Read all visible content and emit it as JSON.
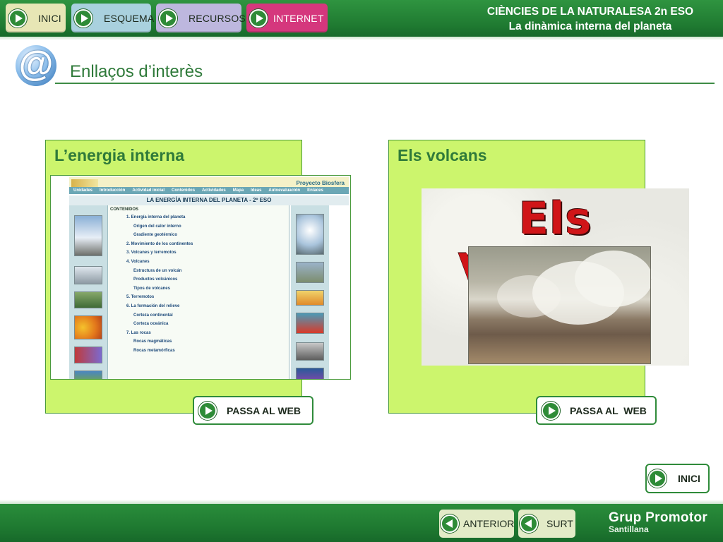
{
  "nav": {
    "inici": "INICI",
    "esquema": "ESQUEMA",
    "recursos": "RECURSOS",
    "internet": "INTERNET"
  },
  "header": {
    "course": "CIÈNCIES DE LA NATURALESA 2n ESO",
    "unit": "La dinàmica interna del planeta"
  },
  "page": {
    "icon": "at-icon",
    "title": "Enllaços d’interès"
  },
  "panels": [
    {
      "title": "L’energia interna",
      "button": "PASSA AL WEB",
      "screenshot": {
        "project": "Proyecto Biosfera",
        "menu": [
          "Unidades",
          "Introducción",
          "Actividad inicial",
          "Contenidos",
          "Actividades",
          "Mapa",
          "Ideas",
          "Autoevaluación",
          "Enlaces"
        ],
        "banner": "LA ENERGÍA INTERNA DEL PLANETA - 2º ESO",
        "contents_heading": "CONTENIDOS",
        "contents": [
          {
            "text": "1. Energía interna del planeta",
            "level": 1
          },
          {
            "text": "Origen del calor interno",
            "level": 2
          },
          {
            "text": "Gradiente geotérmico",
            "level": 2
          },
          {
            "text": "2. Movimiento de los continentes",
            "level": 1
          },
          {
            "text": "3. Volcanes y terremotos",
            "level": 1
          },
          {
            "text": "4. Volcanes",
            "level": 1
          },
          {
            "text": "Estructura de un volcán",
            "level": 2
          },
          {
            "text": "Productos volcánicos",
            "level": 2
          },
          {
            "text": "Tipos de volcanes",
            "level": 2
          },
          {
            "text": "5. Terremotos",
            "level": 1
          },
          {
            "text": "6. La formación del relieve",
            "level": 1
          },
          {
            "text": "Corteza continental",
            "level": 2
          },
          {
            "text": "Corteza oceánica",
            "level": 2
          },
          {
            "text": "7. Las rocas",
            "level": 1
          },
          {
            "text": "Rocas magmáticas",
            "level": 2
          },
          {
            "text": "Rocas metamórficas",
            "level": 2
          }
        ]
      }
    },
    {
      "title": "Els volcans",
      "button": "PASSA AL  WEB",
      "image_title": "Els Volcans"
    }
  ],
  "corner_button": "INICI",
  "footer": {
    "anterior": "ANTERIOR",
    "surt": "SURT",
    "brand_line1": "Grup Promotor",
    "brand_line2": "Santillana"
  },
  "colors": {
    "bar_green": "#1f7a31",
    "panel_green": "#ccf56d",
    "title_green": "#2f7a3a",
    "internet_pink": "#d5377d"
  }
}
